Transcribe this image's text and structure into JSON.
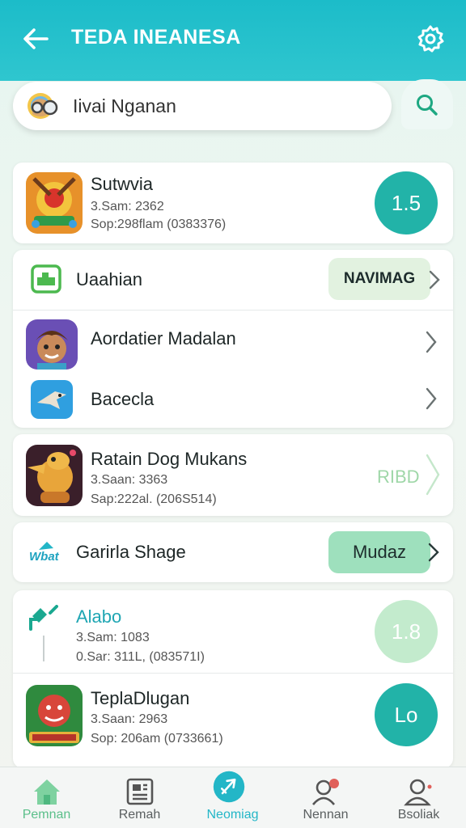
{
  "header": {
    "title": "TEDA INEANESA",
    "back_icon": "arrow-left-icon",
    "settings_icon": "gear-icon",
    "color": "#1cbcc9"
  },
  "search": {
    "value": "Iivai Nganan",
    "placeholder": "Iivai Nganan",
    "icon": "search-icon"
  },
  "cards": [
    {
      "rows": [
        {
          "name": "Sutwvia",
          "meta1": "3.Sam: 2362",
          "meta2": "Sop:298flam (0383376)",
          "action": "1.5",
          "action_type": "circle",
          "action_color": "#22b3a8"
        }
      ]
    },
    {
      "rows": [
        {
          "name": "Uaahian",
          "action": "NAVIMAG",
          "action_type": "pill",
          "action_color": "#e2f2e0"
        },
        {
          "name": "Aordatier Madalan",
          "action_type": "chevron"
        },
        {
          "name": "Bacecla",
          "action_type": "chevron"
        }
      ]
    },
    {
      "rows": [
        {
          "name": "Ratain Dog Mukans",
          "meta1": "3.Saan: 3363",
          "meta2": "Sap:222al.  (206S514)",
          "action": "RIBD",
          "action_type": "text",
          "action_color": "#9fd7a8"
        }
      ]
    },
    {
      "rows": [
        {
          "name": "Garirla Shage",
          "icon_text": "Wbat",
          "action": "Mudaz",
          "action_type": "pill",
          "action_color": "#9ee0bd"
        }
      ]
    },
    {
      "rows": [
        {
          "name": "Alabo",
          "meta1": "3.Sam: 1083",
          "meta2": "0.Sar: 311L,   (083571I)",
          "action": "1.8",
          "action_type": "circle",
          "action_color": "#c3ebcd"
        },
        {
          "name": "TeplaDlugan",
          "meta1": "3.Saan: 2963",
          "meta2": "Sop: 206am (0733661)",
          "action": "Lo",
          "action_type": "circle",
          "action_color": "#22b3a8"
        }
      ]
    }
  ],
  "bottom_nav": [
    {
      "label": "Pemnan",
      "icon": "home-icon",
      "active": false,
      "color": "#5bbf8a"
    },
    {
      "label": "Remah",
      "icon": "news-icon",
      "active": false,
      "color": "#555555"
    },
    {
      "label": "Neomiag",
      "icon": "rocket-icon",
      "active": true,
      "color": "#23b6c7"
    },
    {
      "label": "Nennan",
      "icon": "people-icon",
      "active": false,
      "color": "#555555"
    },
    {
      "label": "Bsoliak",
      "icon": "profile-icon",
      "active": false,
      "color": "#555555"
    }
  ]
}
